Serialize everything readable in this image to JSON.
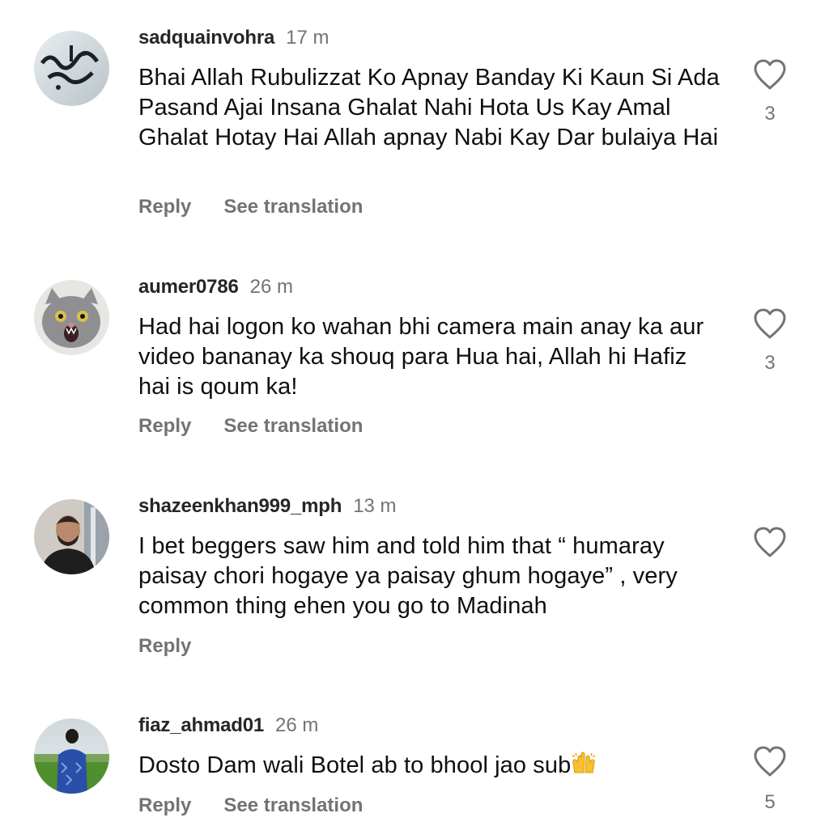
{
  "comments": [
    {
      "username": "sadquainvohra",
      "time": "17 m",
      "text": "Bhai Allah Rubulizzat Ko Apnay Banday Ki Kaun Si Ada Pasand Ajai Insana Ghalat Nahi Hota Us Kay Amal Ghalat Hotay Hai Allah apnay Nabi Kay Dar bulaiya Hai",
      "likes": "3",
      "reply_label": "Reply",
      "translate_label": "See translation"
    },
    {
      "username": "aumer0786",
      "time": "26 m",
      "text": "Had hai logon ko wahan bhi camera main anay ka aur video bananay ka shouq para Hua hai, Allah hi Hafiz hai is qoum ka!",
      "likes": "3",
      "reply_label": "Reply",
      "translate_label": "See translation"
    },
    {
      "username": "shazeenkhan999_mph",
      "time": "13 m",
      "text": "I bet beggers saw him and told him that “ humaray paisay chori hogaye ya paisay ghum hogaye” , very common thing ehen you go to Madinah",
      "likes": "",
      "reply_label": "Reply"
    },
    {
      "username": "fiaz_ahmad01",
      "time": "26 m",
      "text": "Dosto Dam wali Botel ab to bhool jao sub",
      "likes": "5",
      "reply_label": "Reply",
      "translate_label": "See translation"
    }
  ],
  "icons": {
    "like": "heart-outline-icon",
    "emoji": "raising-hands-emoji"
  },
  "colors": {
    "username": "#262626",
    "secondary_text": "#737373",
    "body_text": "#0f0f0f"
  }
}
